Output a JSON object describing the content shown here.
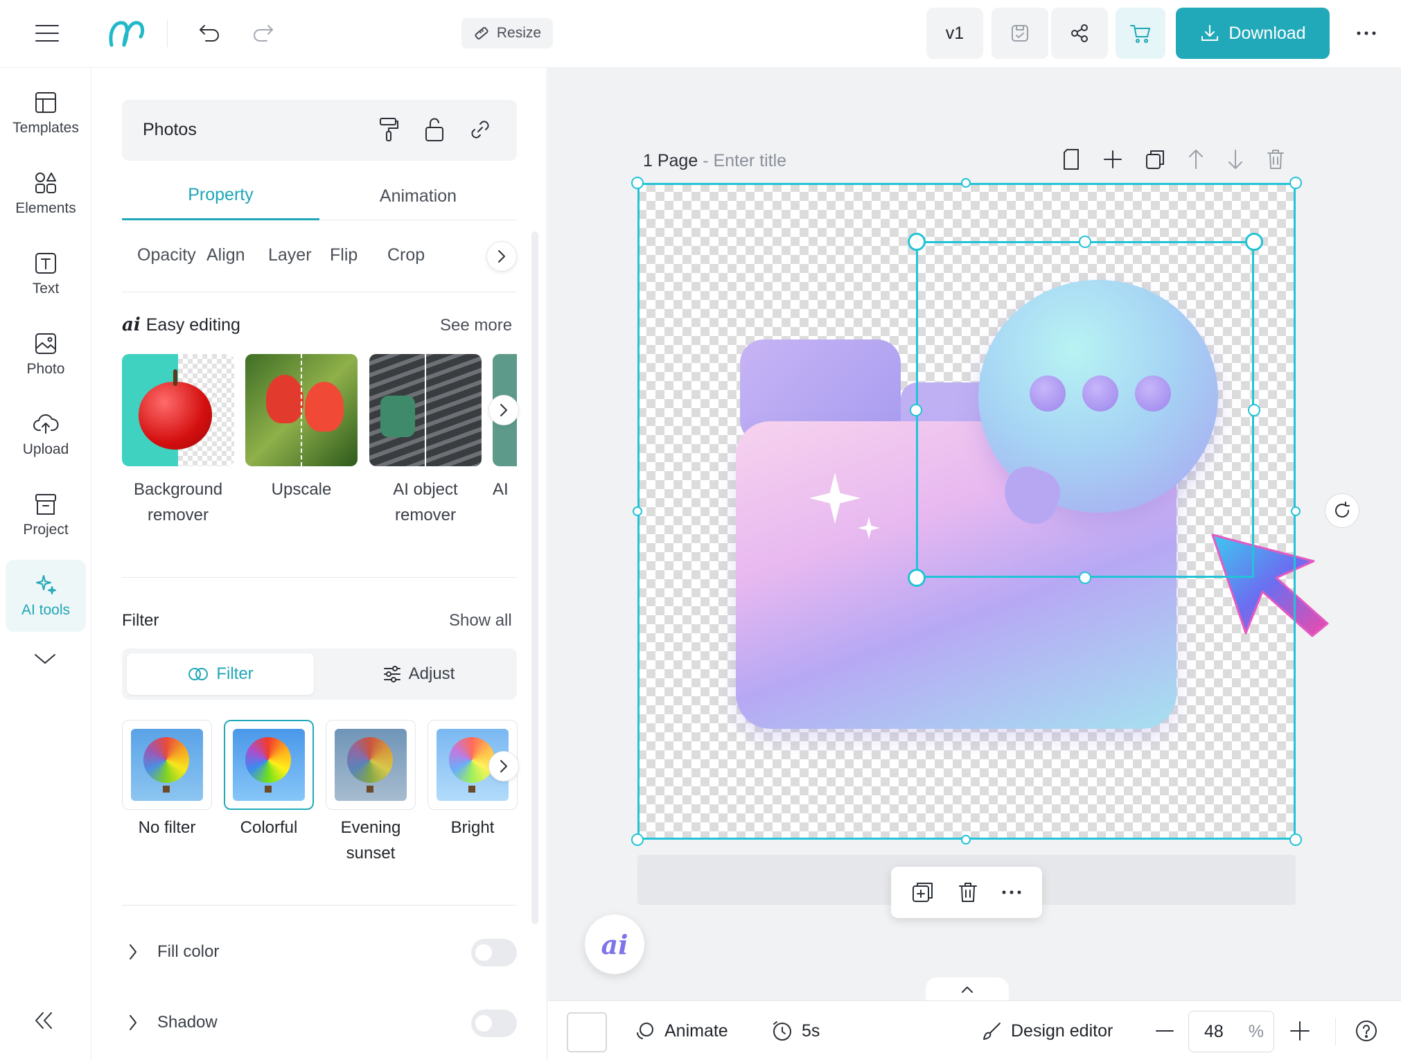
{
  "topbar": {
    "resize_label": "Resize",
    "version_label": "v1",
    "download_label": "Download"
  },
  "rail": {
    "items": [
      {
        "label": "Templates",
        "icon": "templates-icon"
      },
      {
        "label": "Elements",
        "icon": "elements-icon"
      },
      {
        "label": "Text",
        "icon": "text-icon"
      },
      {
        "label": "Photo",
        "icon": "photo-icon"
      },
      {
        "label": "Upload",
        "icon": "upload-icon"
      },
      {
        "label": "Project",
        "icon": "project-icon"
      },
      {
        "label": "AI tools",
        "icon": "ai-sparkle-icon",
        "active": true
      }
    ]
  },
  "panel": {
    "header_title": "Photos",
    "tabs": [
      {
        "label": "Property",
        "active": true
      },
      {
        "label": "Animation",
        "active": false
      }
    ],
    "subtabs": [
      "Opacity",
      "Align",
      "Layer",
      "Flip",
      "Crop"
    ],
    "easy_editing": {
      "badge": "ai",
      "title": "Easy editing",
      "see_more": "See more",
      "cards": [
        {
          "label_line1": "Background",
          "label_line2": "remover"
        },
        {
          "label_line1": "Upscale",
          "label_line2": ""
        },
        {
          "label_line1": "AI object",
          "label_line2": "remover"
        },
        {
          "label_line1": "AI",
          "label_line2": ""
        }
      ]
    },
    "filter": {
      "title": "Filter",
      "show_all": "Show all",
      "segments": [
        {
          "label": "Filter",
          "active": true
        },
        {
          "label": "Adjust",
          "active": false
        }
      ],
      "presets": [
        {
          "label_line1": "No filter",
          "label_line2": "",
          "selected": false
        },
        {
          "label_line1": "Colorful",
          "label_line2": "",
          "selected": true
        },
        {
          "label_line1": "Evening",
          "label_line2": "sunset",
          "selected": false
        },
        {
          "label_line1": "Bright",
          "label_line2": "",
          "selected": false
        }
      ]
    },
    "fill_color": {
      "label": "Fill color",
      "enabled": false
    },
    "shadow": {
      "label": "Shadow",
      "enabled": false
    }
  },
  "canvas": {
    "page_label": "1 Page",
    "separator": " - ",
    "title_placeholder": "Enter title"
  },
  "ai_fab_label": "ai",
  "bottombar": {
    "animate_label": "Animate",
    "duration_label": "5s",
    "design_editor_label": "Design editor",
    "zoom_value": "48",
    "zoom_unit": "%"
  },
  "colors": {
    "accent": "#22a9b9",
    "selection": "#22c3d6",
    "ai_purple": "#7d74e8"
  }
}
